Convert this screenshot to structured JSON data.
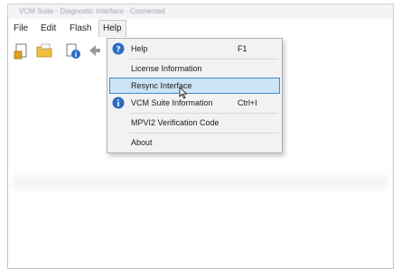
{
  "window": {
    "title": "VCM Suite - Diagnostic Interface - Connected"
  },
  "menubar": {
    "items": [
      {
        "label": "File"
      },
      {
        "label": "Edit"
      },
      {
        "label": "Flash"
      },
      {
        "label": "Help"
      }
    ],
    "open_menu": "Help"
  },
  "toolbar": {
    "buttons": [
      {
        "icon": "open-file-icon"
      },
      {
        "icon": "folder-icon"
      },
      {
        "icon": "document-info-icon"
      },
      {
        "icon": "back-arrow-icon"
      }
    ]
  },
  "help_menu": {
    "items": [
      {
        "label": "Help",
        "shortcut": "F1",
        "icon": "question-circle-icon"
      },
      {
        "label": "License Information"
      },
      {
        "label": "Resync Interface",
        "highlighted": true
      },
      {
        "label": "VCM Suite Information",
        "shortcut": "Ctrl+I",
        "icon": "info-circle-icon"
      },
      {
        "label": "MPVI2 Verification Code"
      },
      {
        "label": "About"
      }
    ]
  },
  "colors": {
    "highlight_bg": "#cce4f7",
    "highlight_border": "#3c8ad6",
    "menu_bg": "#f2f2f2",
    "icon_blue": "#2b6cc4"
  }
}
